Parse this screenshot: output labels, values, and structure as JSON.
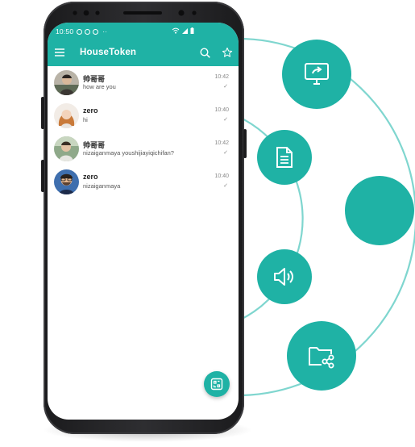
{
  "status_bar": {
    "time": "10:50",
    "extra": "··"
  },
  "app_bar": {
    "title": "HouseToken"
  },
  "chats": [
    {
      "name": "帅哥哥",
      "preview": "how  are  you",
      "time": "10:42",
      "check": "✓"
    },
    {
      "name": "zero",
      "preview": "hi",
      "time": "10:40",
      "check": "✓"
    },
    {
      "name": "帅哥哥",
      "preview": "nizaiganmaya youshijiayiqichifan?",
      "time": "10:42",
      "check": "✓"
    },
    {
      "name": "zero",
      "preview": "nizaiganmaya",
      "time": "10:40",
      "check": "✓"
    }
  ],
  "features": [
    {
      "icon": "screen-share-icon"
    },
    {
      "icon": "document-icon"
    },
    {
      "icon": "blank"
    },
    {
      "icon": "speaker-icon"
    },
    {
      "icon": "folder-share-icon"
    }
  ],
  "colors": {
    "accent": "#1fb2a5",
    "orbit_line": "#7fd6cf"
  }
}
